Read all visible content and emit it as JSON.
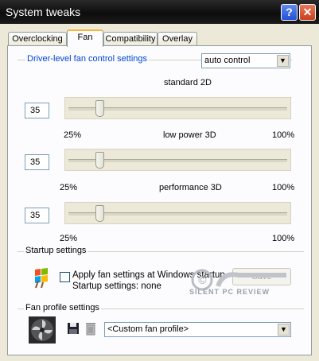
{
  "window": {
    "title": "System tweaks",
    "help_label": "?",
    "close_label": "✕"
  },
  "tabs": [
    {
      "label": "Overclocking",
      "active": false
    },
    {
      "label": "Fan",
      "active": true
    },
    {
      "label": "Compatibility",
      "active": false
    },
    {
      "label": "Overlay",
      "active": false
    }
  ],
  "driver_group": {
    "title": "Driver-level fan control settings",
    "mode_select": "auto control",
    "sections": [
      {
        "title": "standard 2D",
        "value": "35",
        "level_percent": 35,
        "min_label": "25%",
        "max_label": "100%"
      },
      {
        "title": "low power 3D",
        "value": "35",
        "level_percent": 35,
        "min_label": "25%",
        "max_label": "100%"
      },
      {
        "title": "performance 3D",
        "value": "35",
        "level_percent": 35,
        "min_label": "25%",
        "max_label": "100%"
      }
    ]
  },
  "startup_group": {
    "title": "Startup settings",
    "checkbox_label": "Apply fan settings at Windows startup",
    "checked": false,
    "status_text": "Startup settings:  none",
    "save_label": "Save"
  },
  "profile_group": {
    "title": "Fan profile settings",
    "profile_select": "<Custom fan profile>"
  },
  "watermark": {
    "text": "SILENT PC REVIEW"
  },
  "colors": {
    "group_title": "#0046d5",
    "active_tab_accent": "#f7b53a",
    "window_bg": "#ECE9D8"
  }
}
